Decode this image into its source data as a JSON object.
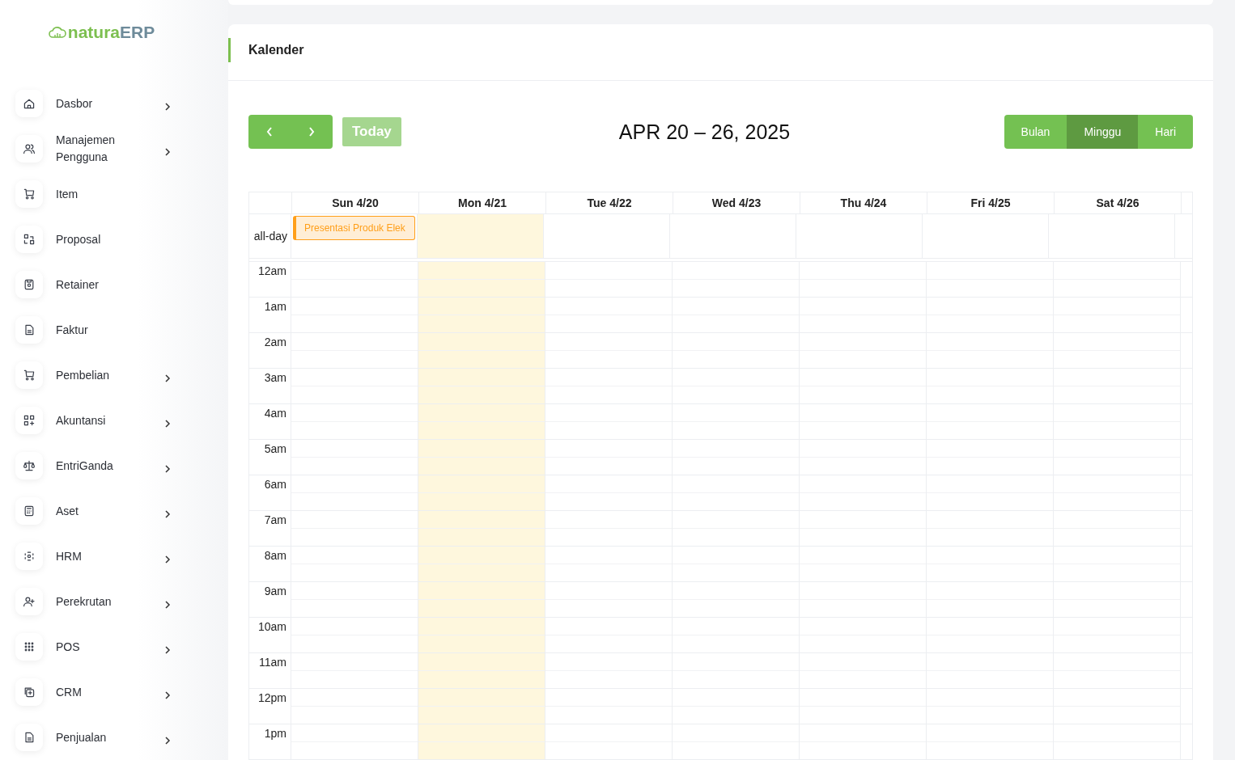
{
  "logo": {
    "prefix": "natura",
    "suffix": "ERP"
  },
  "sidebar": {
    "items": [
      {
        "label": "Dasbor",
        "has_submenu": true
      },
      {
        "label": "Manajemen Pengguna",
        "has_submenu": true
      },
      {
        "label": "Item",
        "has_submenu": false
      },
      {
        "label": "Proposal",
        "has_submenu": false
      },
      {
        "label": "Retainer",
        "has_submenu": false
      },
      {
        "label": "Faktur",
        "has_submenu": false
      },
      {
        "label": "Pembelian",
        "has_submenu": true
      },
      {
        "label": "Akuntansi",
        "has_submenu": true
      },
      {
        "label": "EntriGanda",
        "has_submenu": true
      },
      {
        "label": "Aset",
        "has_submenu": true
      },
      {
        "label": "HRM",
        "has_submenu": true
      },
      {
        "label": "Perekrutan",
        "has_submenu": true
      },
      {
        "label": "POS",
        "has_submenu": true
      },
      {
        "label": "CRM",
        "has_submenu": true
      },
      {
        "label": "Penjualan",
        "has_submenu": true
      }
    ]
  },
  "page_title": "Kalender",
  "toolbar": {
    "today": "Today",
    "today_disabled": true,
    "range": "APR 20 – 26, 2025",
    "views": [
      {
        "label": "Bulan",
        "selected": false
      },
      {
        "label": "Minggu",
        "selected": true
      },
      {
        "label": "Hari",
        "selected": false
      }
    ]
  },
  "calendar": {
    "allday_label": "all-day",
    "days": [
      {
        "label": "Sun 4/20",
        "today": false,
        "events": [
          {
            "title": "Presentasi Produk Elek",
            "color": "#ff9f1a"
          }
        ]
      },
      {
        "label": "Mon 4/21",
        "today": true
      },
      {
        "label": "Tue 4/22",
        "today": false
      },
      {
        "label": "Wed 4/23",
        "today": false
      },
      {
        "label": "Thu 4/24",
        "today": false
      },
      {
        "label": "Fri 4/25",
        "today": false
      },
      {
        "label": "Sat 4/26",
        "today": false
      }
    ],
    "hours": [
      "12am",
      "1am",
      "2am",
      "3am",
      "4am",
      "5am",
      "6am",
      "7am",
      "8am",
      "9am",
      "10am",
      "11am",
      "12pm",
      "1pm"
    ]
  }
}
